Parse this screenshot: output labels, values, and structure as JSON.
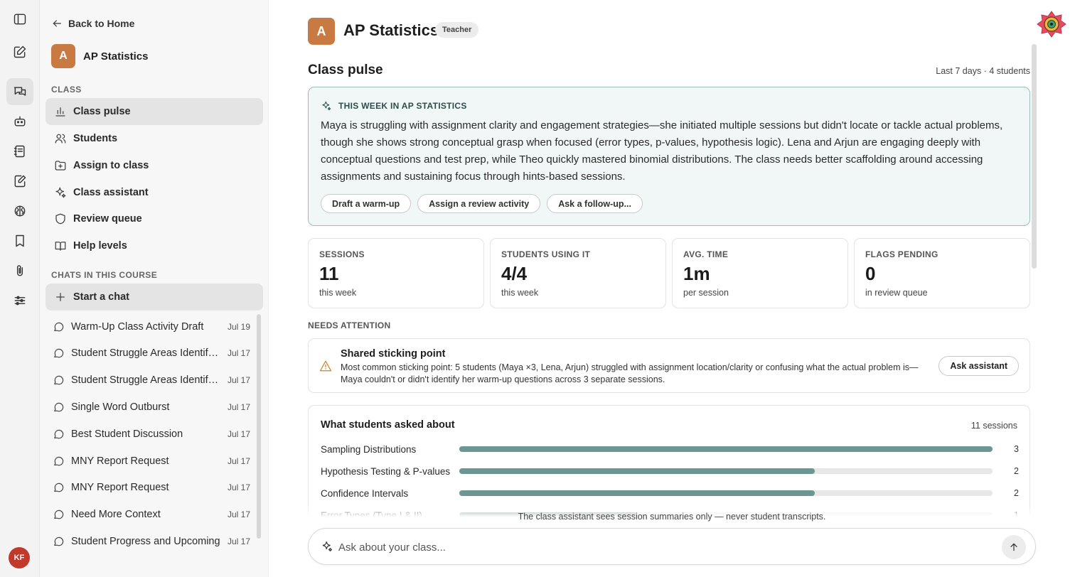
{
  "rail": {
    "icons": [
      "sidebar-toggle-icon",
      "compose-icon",
      "chats-icon",
      "robot-icon",
      "notebook-icon",
      "edit-document-icon",
      "brain-icon",
      "bookmark-icon",
      "paperclip-icon",
      "sliders-icon"
    ],
    "active": "chats-icon",
    "avatar_initials": "KF",
    "avatar_color": "#c0392b"
  },
  "sidebar": {
    "back_label": "Back to Home",
    "course_initial": "A",
    "course_name": "AP Statistics",
    "class_heading": "CLASS",
    "nav_items": [
      {
        "label": "Class pulse",
        "icon": "bar-chart-icon",
        "active": true
      },
      {
        "label": "Students",
        "icon": "users-icon"
      },
      {
        "label": "Assign to class",
        "icon": "folder-plus-icon"
      },
      {
        "label": "Class assistant",
        "icon": "sparkle-icon"
      },
      {
        "label": "Review queue",
        "icon": "shield-icon"
      },
      {
        "label": "Help levels",
        "icon": "book-icon"
      }
    ],
    "chats_heading": "CHATS IN THIS COURSE",
    "start_chat_label": "Start a chat",
    "chats": [
      {
        "title": "Warm-Up Class Activity Draft",
        "date": "Jul 19"
      },
      {
        "title": "Student Struggle Areas Identified",
        "date": "Jul 17"
      },
      {
        "title": "Student Struggle Areas Identified",
        "date": "Jul 17"
      },
      {
        "title": "Single Word Outburst",
        "date": "Jul 17"
      },
      {
        "title": "Best Student Discussion",
        "date": "Jul 17"
      },
      {
        "title": "MNY Report Request",
        "date": "Jul 17"
      },
      {
        "title": "MNY Report Request",
        "date": "Jul 17"
      },
      {
        "title": "Need More Context",
        "date": "Jul 17"
      },
      {
        "title": "Student Progress and Upcoming",
        "date": "Jul 17"
      }
    ]
  },
  "header": {
    "course_initial": "A",
    "course_name": "AP Statistics",
    "role": "Teacher",
    "brand_color": "#c97a43"
  },
  "pulse": {
    "title": "Class pulse",
    "range": "Last 7 days · 4 students",
    "week": {
      "heading": "THIS WEEK IN AP STATISTICS",
      "summary": "Maya is struggling with assignment clarity and engagement strategies—she initiated multiple sessions but didn't locate or tackle actual problems, though she shows strong conceptual grasp when focused (error types, p-values, hypothesis logic). Lena and Arjun are engaging deeply with conceptual questions and test prep, while Theo quickly mastered binomial distributions. The class needs better scaffolding around accessing assignments and sustaining focus through hints-based sessions.",
      "actions": [
        "Draft a warm-up",
        "Assign a review activity",
        "Ask a follow-up..."
      ]
    },
    "stats": [
      {
        "label": "SESSIONS",
        "value": "11",
        "sub": "this week"
      },
      {
        "label": "STUDENTS USING IT",
        "value": "4/4",
        "sub": "this week"
      },
      {
        "label": "AVG. TIME",
        "value": "1m",
        "sub": "per session"
      },
      {
        "label": "FLAGS PENDING",
        "value": "0",
        "sub": "in review queue"
      }
    ],
    "needs_attention": {
      "heading": "NEEDS ATTENTION",
      "title": "Shared sticking point",
      "text": "Most common sticking point: 5 students (Maya ×3, Lena, Arjun) struggled with assignment location/clarity or confusing what the actual problem is—Maya couldn't or didn't identify her warm-up questions across 3 separate sessions.",
      "action": "Ask assistant"
    },
    "topics": {
      "title": "What students asked about",
      "count": "11 sessions",
      "max": 3,
      "items": [
        {
          "label": "Sampling Distributions",
          "value": 3
        },
        {
          "label": "Hypothesis Testing & P-values",
          "value": 2
        },
        {
          "label": "Confidence Intervals",
          "value": 2
        },
        {
          "label": "Error Types (Type I & II)",
          "value": 1
        }
      ]
    },
    "accent": "#6d9692"
  },
  "composer": {
    "disclaimer": "The class assistant sees session summaries only — never student transcripts.",
    "placeholder": "Ask about your class..."
  }
}
